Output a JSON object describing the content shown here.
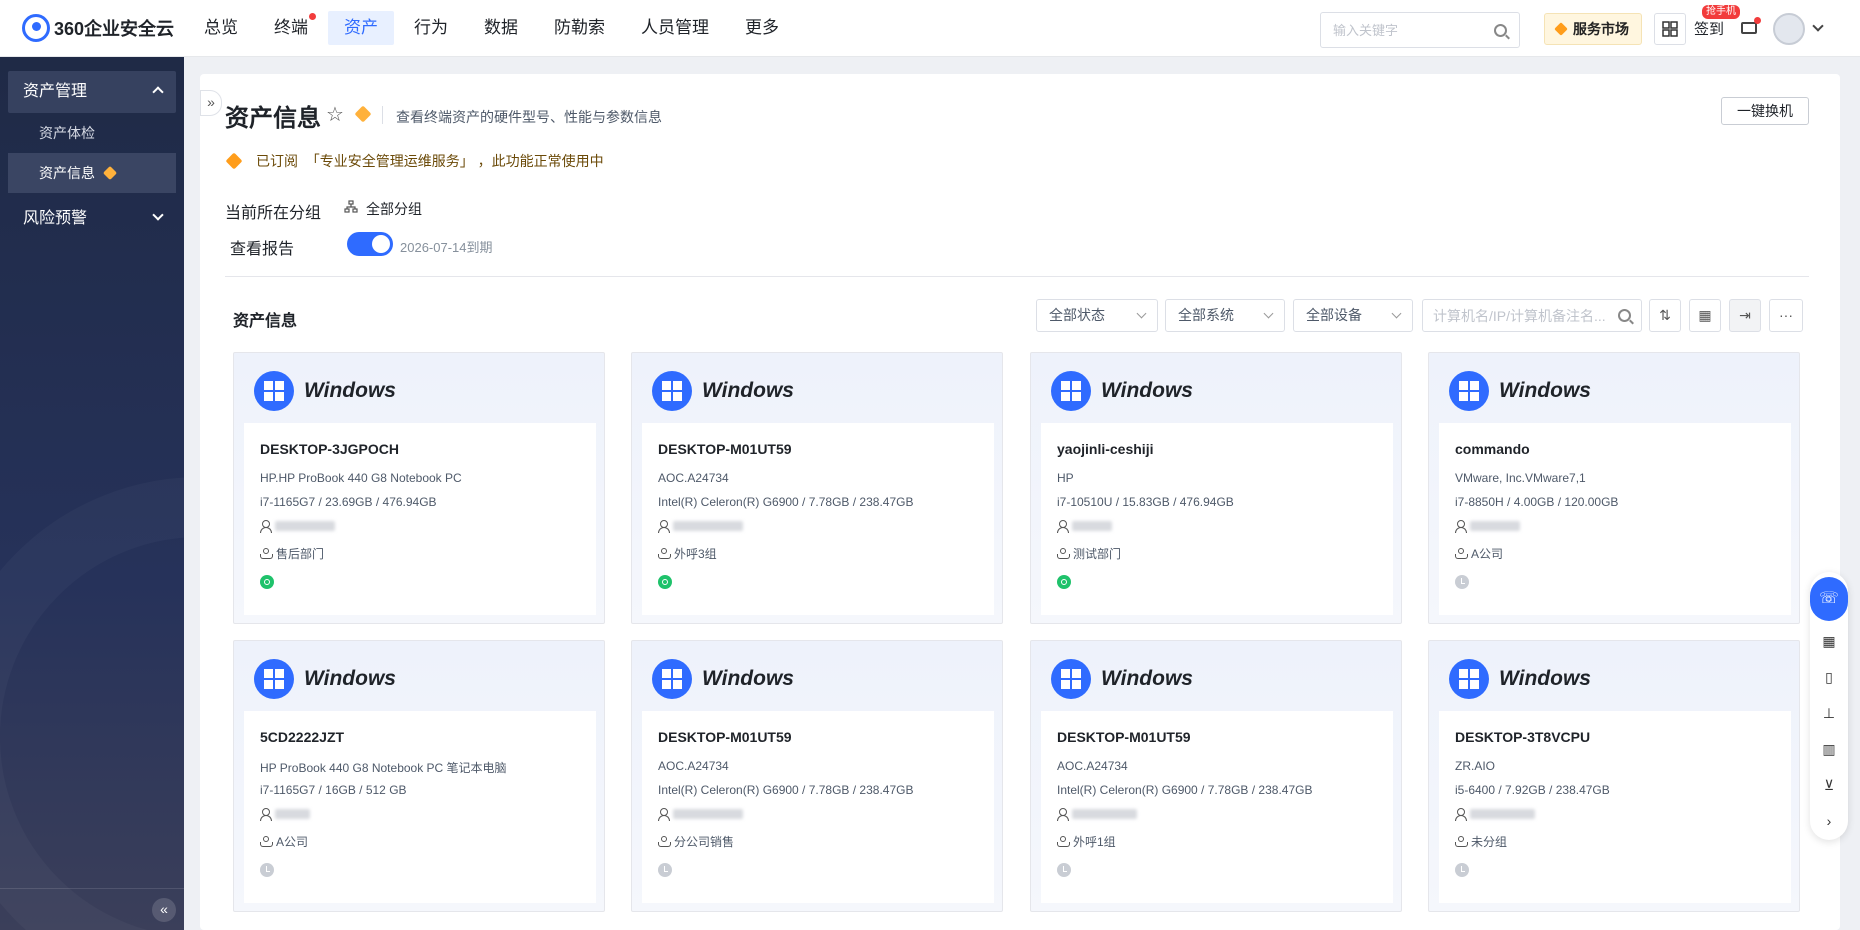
{
  "brand": {
    "name": "360企业安全云"
  },
  "nav": {
    "items": [
      {
        "label": "总览",
        "active": false,
        "dot": false
      },
      {
        "label": "终端",
        "active": false,
        "dot": true
      },
      {
        "label": "资产",
        "active": true,
        "dot": false
      },
      {
        "label": "行为",
        "active": false,
        "dot": false
      },
      {
        "label": "数据",
        "active": false,
        "dot": false
      },
      {
        "label": "防勒索",
        "active": false,
        "dot": false
      },
      {
        "label": "人员管理",
        "active": false,
        "dot": false
      },
      {
        "label": "更多",
        "active": false,
        "dot": false
      }
    ],
    "search_placeholder": "输入关键字",
    "market_label": "服务市场",
    "sign_label": "签到",
    "sign_badge": "抢手机"
  },
  "sidebar": {
    "group1": "资产管理",
    "items": [
      "资产体检",
      "资产信息"
    ],
    "group2": "风险预警",
    "collapse_icon": "«"
  },
  "page": {
    "title": "资产信息",
    "subtitle": "查看终端资产的硬件型号、性能与参数信息",
    "swap_button": "一键换机",
    "subscription": "已订阅  「专业安全管理运维服务」 ，此功能正常使用中",
    "group_label": "当前所在分组",
    "group_value": "全部分组",
    "report_label": "查看报告",
    "report_expire": "2026-07-14到期"
  },
  "section": {
    "title": "资产信息",
    "filters": [
      "全部状态",
      "全部系统",
      "全部设备"
    ],
    "search_placeholder": "计算机名/IP/计算机备注名..."
  },
  "cards": [
    {
      "os": "Windows",
      "name": "DESKTOP-3JGPOCH",
      "model": "HP.HP ProBook 440 G8 Notebook PC",
      "spec": "i7-1165G7 / 23.69GB / 476.94GB",
      "dept": "售后部门",
      "status": "online"
    },
    {
      "os": "Windows",
      "name": "DESKTOP-M01UT59",
      "model": "AOC.A24734",
      "spec": "Intel(R) Celeron(R) G6900 / 7.78GB / 238.47GB",
      "dept": "外呼3组",
      "status": "online"
    },
    {
      "os": "Windows",
      "name": "yaojinli-ceshiji",
      "model": "HP",
      "spec": "i7-10510U / 15.83GB / 476.94GB",
      "dept": "测试部门",
      "status": "online"
    },
    {
      "os": "Windows",
      "name": "commando",
      "model": "VMware, Inc.VMware7,1",
      "spec": "i7-8850H / 4.00GB / 120.00GB",
      "dept": "A公司",
      "status": "offline"
    },
    {
      "os": "Windows",
      "name": "5CD2222JZT",
      "model": "HP ProBook 440 G8 Notebook PC 笔记本电脑",
      "spec": "i7-1165G7 / 16GB / 512 GB",
      "dept": "A公司",
      "status": "offline"
    },
    {
      "os": "Windows",
      "name": "DESKTOP-M01UT59",
      "model": "AOC.A24734",
      "spec": "Intel(R) Celeron(R) G6900 / 7.78GB / 238.47GB",
      "dept": "分公司销售",
      "status": "offline"
    },
    {
      "os": "Windows",
      "name": "DESKTOP-M01UT59",
      "model": "AOC.A24734",
      "spec": "Intel(R) Celeron(R) G6900 / 7.78GB / 238.47GB",
      "dept": "外呼1组",
      "status": "offline"
    },
    {
      "os": "Windows",
      "name": "DESKTOP-3T8VCPU",
      "model": "ZR.AIO",
      "spec": "i5-6400 / 7.92GB / 238.47GB",
      "dept": "未分组",
      "status": "offline"
    }
  ],
  "colors": {
    "accent": "#2f6bff",
    "online": "#1fc26b",
    "offline": "#c9cdd4",
    "sidebar": "#1f2a46"
  }
}
